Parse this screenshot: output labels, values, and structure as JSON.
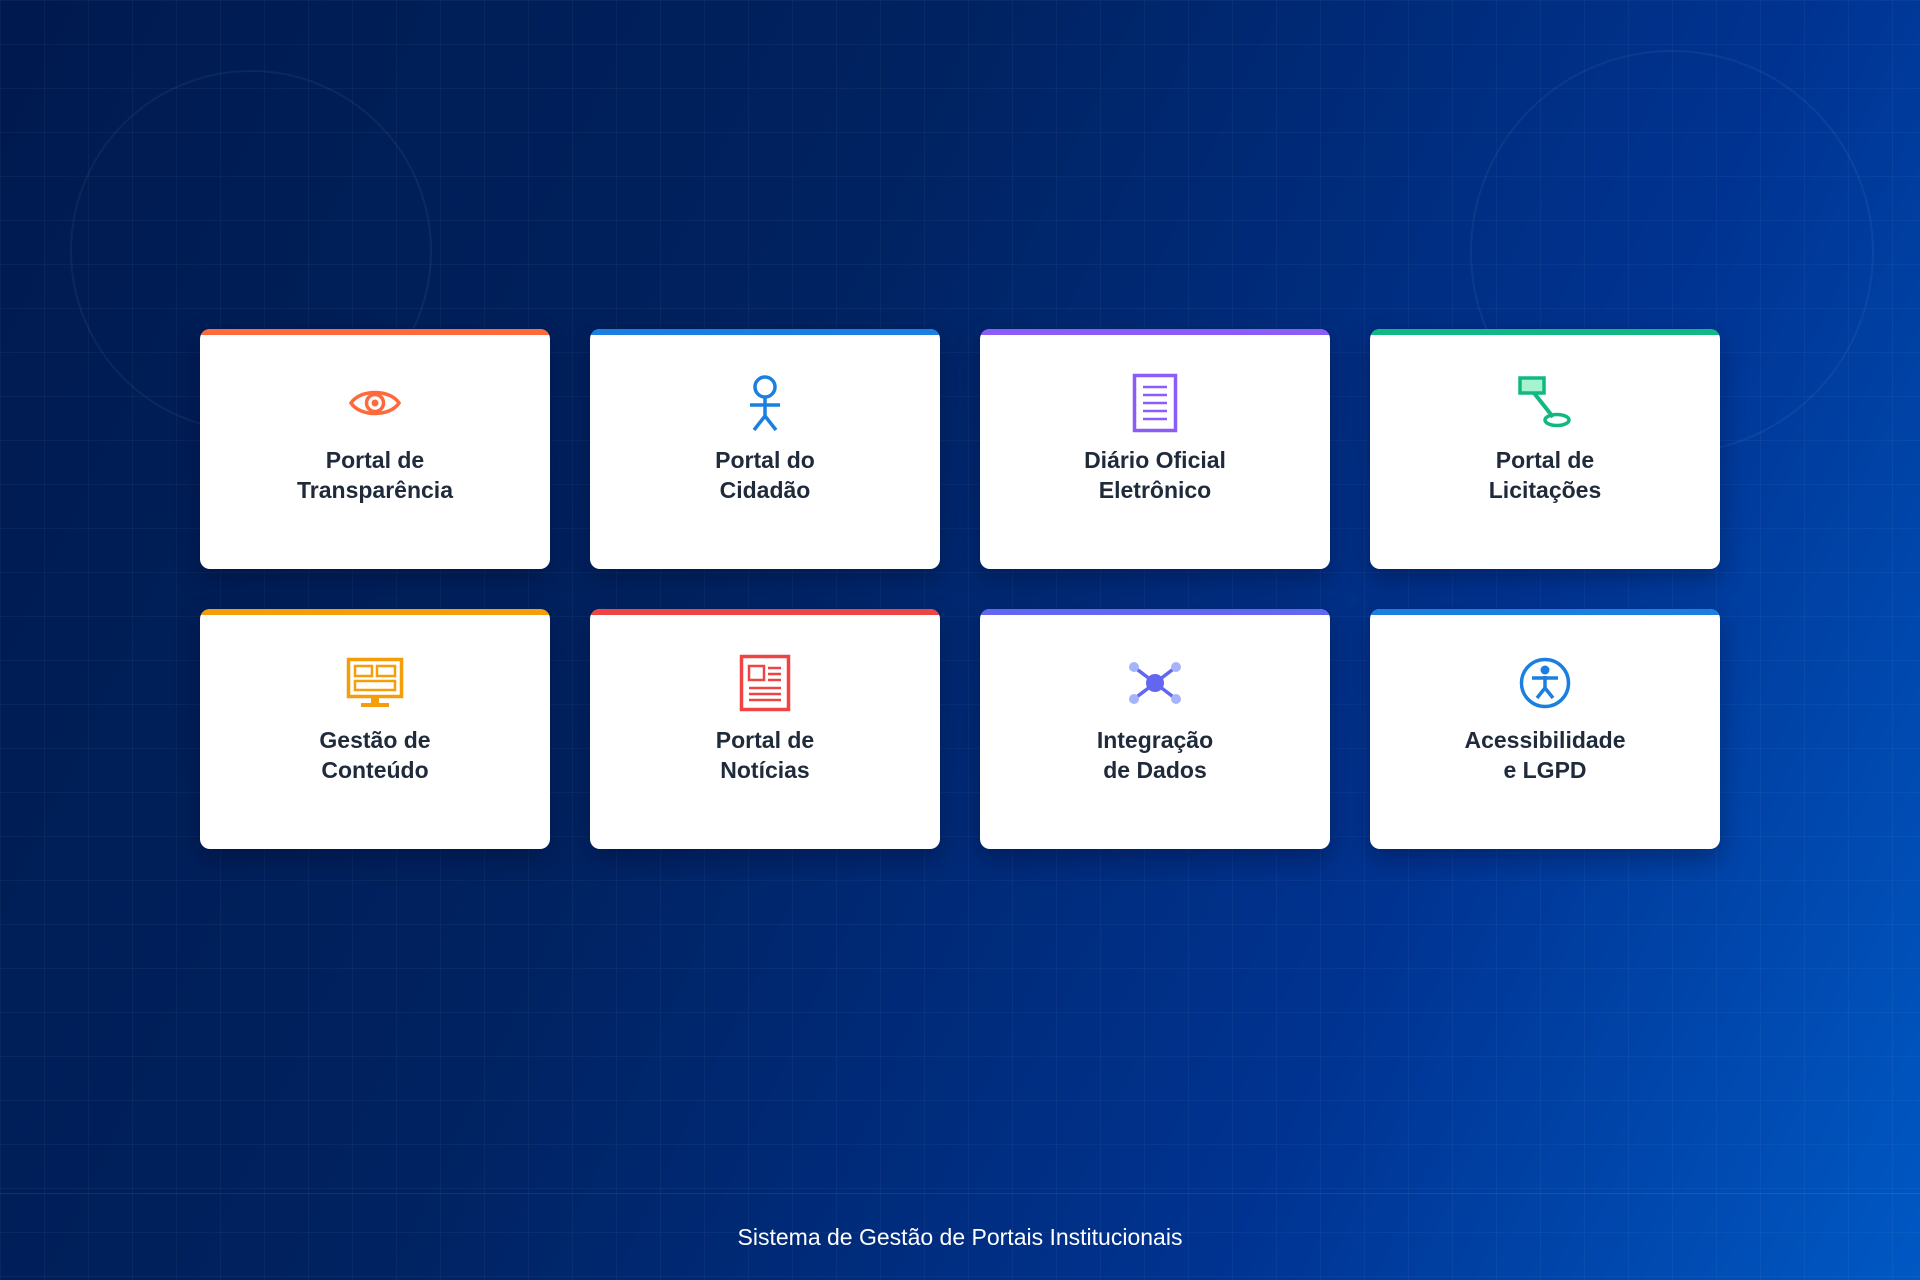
{
  "cards": [
    {
      "line1": "Portal de",
      "line2": "Transparência",
      "accent": "#ff6a3d",
      "icon": "eye-icon"
    },
    {
      "line1": "Portal do",
      "line2": "Cidadão",
      "accent": "#1a7fe0",
      "icon": "person-icon"
    },
    {
      "line1": "Diário Oficial",
      "line2": "Eletrônico",
      "accent": "#8b5cf6",
      "icon": "document-icon"
    },
    {
      "line1": "Portal de",
      "line2": "Licitações",
      "accent": "#10b981",
      "icon": "gavel-icon"
    },
    {
      "line1": "Gestão de",
      "line2": "Conteúdo",
      "accent": "#f59e0b",
      "icon": "monitor-icon"
    },
    {
      "line1": "Portal de",
      "line2": "Notícias",
      "accent": "#ef4444",
      "icon": "newspaper-icon"
    },
    {
      "line1": "Integração",
      "line2": "de Dados",
      "accent": "#6366f1",
      "icon": "network-icon"
    },
    {
      "line1": "Acessibilidade",
      "line2": "e LGPD",
      "accent": "#1a7fe0",
      "icon": "accessibility-icon"
    }
  ],
  "footer": {
    "text": "Sistema de Gestão de Portais Institucionais"
  }
}
